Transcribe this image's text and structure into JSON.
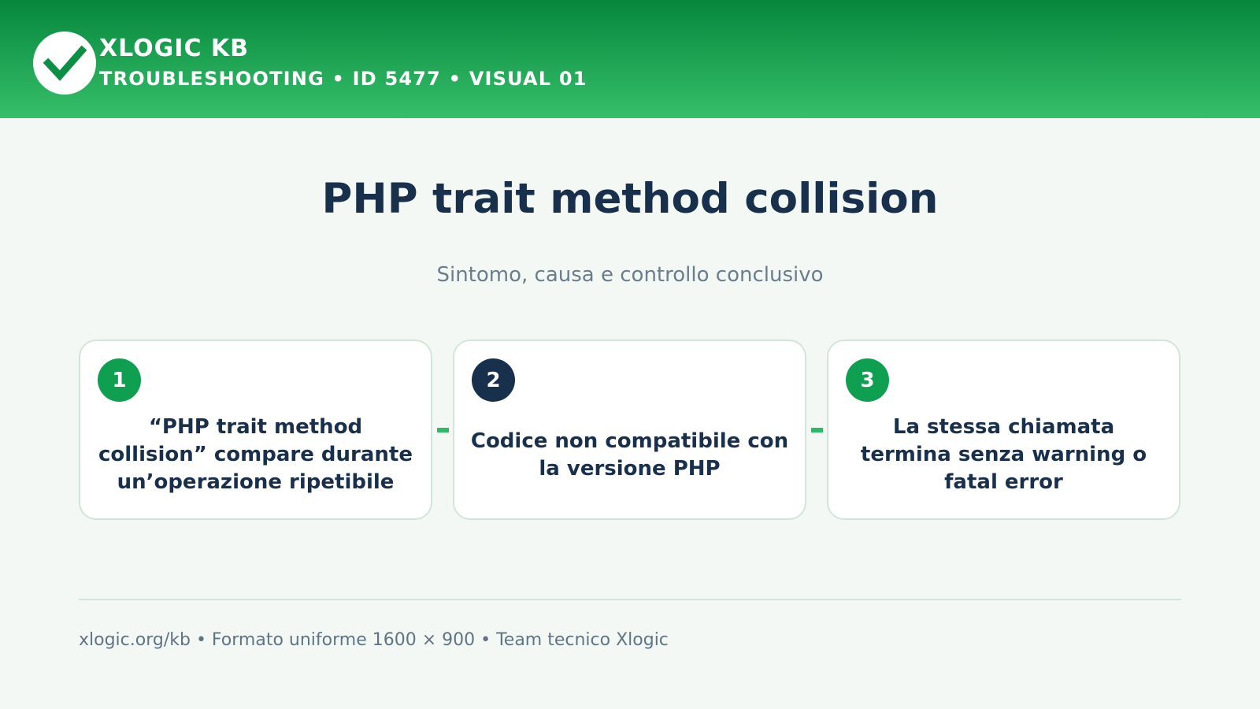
{
  "colors": {
    "header_dark": "#06873c",
    "header_light": "#36bf6a",
    "accent_green": "#0f9f50",
    "navy": "#19304d",
    "background": "#f4f8f5"
  },
  "header": {
    "logo_icon": "checkmark-icon",
    "brand": "XLOGIC KB",
    "breadcrumb": "TROUBLESHOOTING • ID 5477 • VISUAL 01"
  },
  "main": {
    "title": "PHP trait method collision",
    "subtitle": "Sintomo, causa e controllo conclusivo",
    "cards": [
      {
        "number": "1",
        "text": "“PHP trait method collision” compare durante un’operazione ripetibile",
        "badge_color": "#0f9f50"
      },
      {
        "number": "2",
        "text": "Codice non compatibile con la versione PHP",
        "badge_color": "#19304d"
      },
      {
        "number": "3",
        "text": "La stessa chiamata termina senza warning o fatal error",
        "badge_color": "#0f9f50"
      }
    ]
  },
  "footer": {
    "text": "xlogic.org/kb • Formato uniforme 1600 × 900 • Team tecnico Xlogic"
  }
}
